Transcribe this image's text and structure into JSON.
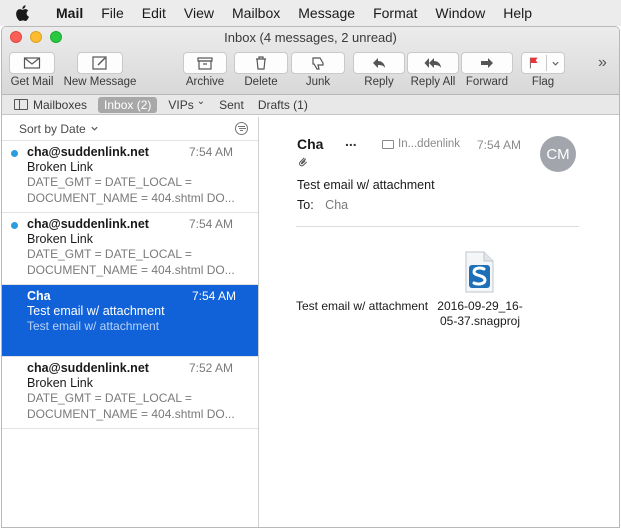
{
  "menubar": {
    "apple_icon": "apple-logo-icon",
    "items": [
      "Mail",
      "File",
      "Edit",
      "View",
      "Mailbox",
      "Message",
      "Format",
      "Window",
      "Help"
    ]
  },
  "window": {
    "title": "Inbox (4 messages, 2 unread)"
  },
  "toolbar": {
    "get_mail": "Get Mail",
    "new_message": "New Message",
    "archive": "Archive",
    "delete": "Delete",
    "junk": "Junk",
    "reply": "Reply",
    "reply_all": "Reply All",
    "forward": "Forward",
    "flag": "Flag",
    "overflow": "»",
    "flag_color": "#e8353b"
  },
  "favorites": {
    "mailboxes": "Mailboxes",
    "inbox": "Inbox (2)",
    "vips": "VIPs",
    "vips_chevron": "⌄",
    "sent": "Sent",
    "drafts": "Drafts (1)"
  },
  "list": {
    "sort_label": "Sort by Date",
    "messages": [
      {
        "from": "cha@suddenlink.net",
        "time": "7:54 AM",
        "subject": "Broken Link",
        "preview1": "DATE_GMT = DATE_LOCAL =",
        "preview2": "DOCUMENT_NAME = 404.shtml DO...",
        "unread": true,
        "selected": false
      },
      {
        "from": "cha@suddenlink.net",
        "time": "7:54 AM",
        "subject": "Broken Link",
        "preview1": "DATE_GMT = DATE_LOCAL =",
        "preview2": "DOCUMENT_NAME = 404.shtml DO...",
        "unread": true,
        "selected": false
      },
      {
        "from": "Cha",
        "time": "7:54 AM",
        "subject": "Test email w/ attachment",
        "preview1": "Test email w/ attachment",
        "preview2": "",
        "unread": false,
        "selected": true
      },
      {
        "from": "cha@suddenlink.net",
        "time": "7:52 AM",
        "subject": "Broken Link",
        "preview1": "DATE_GMT = DATE_LOCAL =",
        "preview2": "DOCUMENT_NAME = 404.shtml DO...",
        "unread": false,
        "selected": false
      }
    ],
    "selection_color": "#1162d8",
    "unread_dot_color": "#2d9cdb"
  },
  "reader": {
    "from": "Cha",
    "more": "...",
    "folder": "In...ddenlink",
    "time": "7:54 AM",
    "avatar_initials": "CM",
    "attachment_icon": "paperclip-icon",
    "subject": "Test email w/ attachment",
    "to_label": "To:",
    "to_name": "Cha",
    "body_text": "Test email w/ attachment",
    "attachment_name_line1": "2016-09-29_16-",
    "attachment_name_line2": "05-37.snagproj",
    "attachment_file_icon": "snagit-file-icon"
  }
}
